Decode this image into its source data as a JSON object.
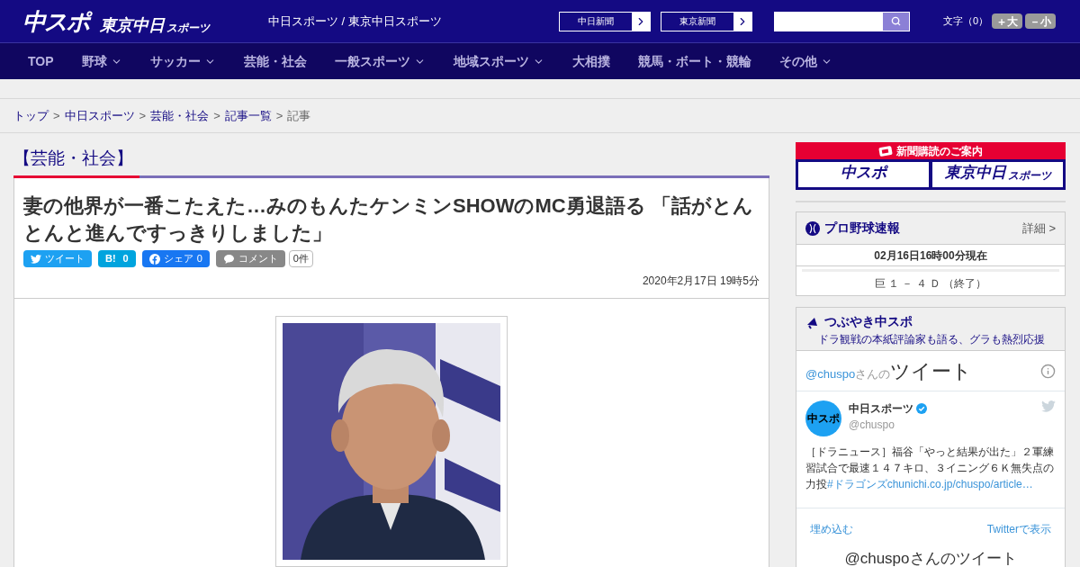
{
  "header": {
    "logo_main": "中スポ",
    "logo_sub": "東京中日",
    "logo_sub_small": "スポーツ",
    "site_title": "中日スポーツ / 東京中日スポーツ",
    "links": [
      "中日新聞",
      "東京新聞"
    ],
    "font_size_label": "文字（0）",
    "font_buttons": [
      "＋大",
      "－小"
    ]
  },
  "nav": [
    {
      "label": "TOP",
      "dropdown": false
    },
    {
      "label": "野球",
      "dropdown": true
    },
    {
      "label": "サッカー",
      "dropdown": true
    },
    {
      "label": "芸能・社会",
      "dropdown": false
    },
    {
      "label": "一般スポーツ",
      "dropdown": true
    },
    {
      "label": "地域スポーツ",
      "dropdown": true
    },
    {
      "label": "大相撲",
      "dropdown": false
    },
    {
      "label": "競馬・ボート・競輪",
      "dropdown": false
    },
    {
      "label": "その他",
      "dropdown": true
    }
  ],
  "breadcrumb_separator": ">",
  "breadcrumb": [
    {
      "label": "トップ",
      "link": true
    },
    {
      "label": "中日スポーツ",
      "link": true
    },
    {
      "label": "芸能・社会",
      "link": true
    },
    {
      "label": "記事一覧",
      "link": true
    },
    {
      "label": "記事",
      "link": false
    }
  ],
  "category": "【芸能・社会】",
  "article": {
    "title": "妻の他界が一番こたえた…みのもんたケンミンSHOWのMC勇退語る 「話がとんとんと進んですっきりしました」",
    "share": [
      {
        "kind": "twitter",
        "label": "ツイート"
      },
      {
        "kind": "hatena",
        "label": "B!",
        "count": "0"
      },
      {
        "kind": "facebook",
        "label": "シェア",
        "count": "0"
      },
      {
        "kind": "comment",
        "label": "コメント",
        "count": "0件"
      }
    ],
    "date": "2020年2月17日 19時5分"
  },
  "sidebar": {
    "subscribe": {
      "title": "新聞購読のご案内",
      "logos": [
        "中スポ",
        "東京中日"
      ],
      "logo_small": "スポーツ"
    },
    "baseball": {
      "title": "プロ野球速報",
      "detail": "詳細 >",
      "updated": "02月16日16時00分現在",
      "score": "巨 １ － ４ Ｄ （終了）"
    },
    "tweets": {
      "title": "つぶやき中スポ",
      "subtitle": "ドラ観戦の本紙評論家も語る、グラも熱烈応援",
      "handle": "@chuspo",
      "handle_suffix": "さんの",
      "heading": "ツイート",
      "account_name": "中日スポーツ",
      "verified": true,
      "account_handle": "@chuspo",
      "avatar": "中スポ",
      "text": "［ドラニュース］福谷「やっと結果が出た」２軍練習試合で最速１４７キロ、３イニング６Ｋ無失点の力投",
      "hashtag": "#ドラゴンズ",
      "link": "chunichi.co.jp/chuspo/article…",
      "embed": "埋め込む",
      "view": "Twitterで表示",
      "footer": "@chuspoさんのツイート"
    }
  }
}
